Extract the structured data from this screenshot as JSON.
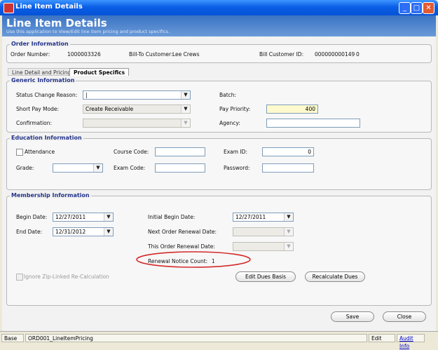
{
  "window": {
    "title": "Line Item Details",
    "title_color": "#0a5fe6"
  },
  "header": {
    "title": "Line Item Details",
    "subtitle": "Use this application to View/Edit line item pricing and product specifics."
  },
  "order_info": {
    "legend": "Order Information",
    "order_number_label": "Order Number:",
    "order_number": "1000003326",
    "bill_to_label": "Bill-To Customer:",
    "bill_to": "Lee Crews",
    "bill_id_label": "Bill Customer ID:",
    "bill_id": "000000000149",
    "bill_id_suffix": "0"
  },
  "tabs": [
    {
      "label": "Line Detail and Pricing",
      "active": false
    },
    {
      "label": "Product Specifics",
      "active": true
    }
  ],
  "generic": {
    "legend": "Generic Information",
    "status_change_reason_label": "Status Change Reason:",
    "status_change_reason": "|",
    "short_pay_mode_label": "Short Pay Mode:",
    "short_pay_mode": "Create Receivable",
    "confirmation_label": "Confirmation:",
    "confirmation": "",
    "batch_label": "Batch:",
    "pay_priority_label": "Pay Priority:",
    "pay_priority": "400",
    "agency_label": "Agency:",
    "agency": ""
  },
  "education": {
    "legend": "Education Information",
    "attendance_label": "Attendance",
    "grade_label": "Grade:",
    "grade": "",
    "course_code_label": "Course Code:",
    "course_code": "",
    "exam_code_label": "Exam Code:",
    "exam_code": "",
    "exam_id_label": "Exam ID:",
    "exam_id": "0",
    "password_label": "Password:",
    "password": ""
  },
  "membership": {
    "legend": "Membership Information",
    "begin_date_label": "Begin Date:",
    "begin_date": "12/27/2011",
    "end_date_label": "End Date:",
    "end_date": "12/31/2012",
    "initial_begin_label": "Initial Begin Date:",
    "initial_begin": "12/27/2011",
    "next_renewal_label": "Next Order Renewal Date:",
    "next_renewal": "",
    "this_renewal_label": "This Order Renewal Date:",
    "this_renewal": "",
    "renewal_count_label": "Renewal Notice Count:",
    "renewal_count": "1",
    "ignore_zip_label": "Ignore Zip-Linked Re-Calculation",
    "edit_dues_label": "Edit Dues Basis",
    "recalc_dues_label": "Recalculate Dues"
  },
  "buttons": {
    "save": "Save",
    "close": "Close"
  },
  "status": {
    "base": "Base",
    "module": "ORD001_LineItemPricing",
    "mode": "Edit",
    "audit": "Audit Info"
  },
  "icons": [
    "app-icon",
    "minimize-icon",
    "maximize-icon",
    "close-icon",
    "dropdown-arrow-icon",
    "checkbox-icon"
  ],
  "colors": {
    "header_blue": "#3a73c4",
    "legend_text": "#23338a",
    "highlight_yellow": "#fffacd",
    "annotation_red": "#d42b2b"
  }
}
